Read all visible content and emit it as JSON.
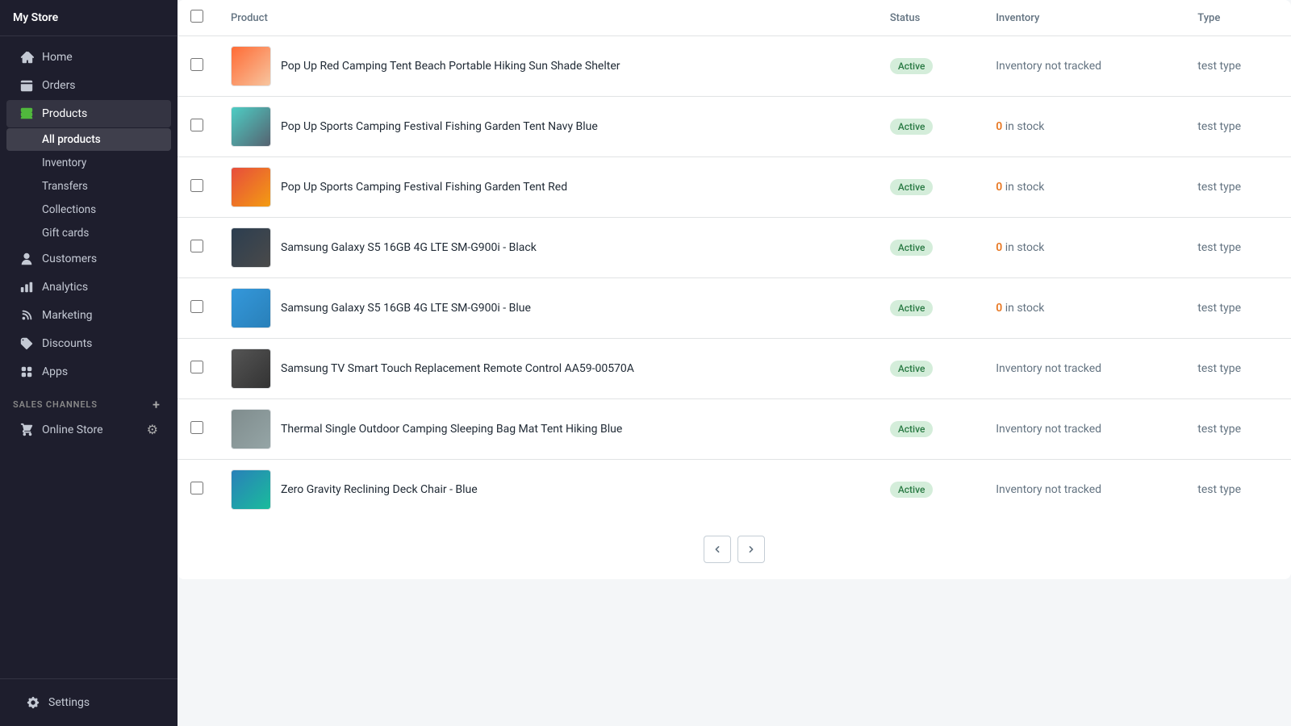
{
  "sidebar": {
    "store_name": "My Store",
    "nav_items": [
      {
        "id": "home",
        "label": "Home",
        "icon": "home"
      },
      {
        "id": "orders",
        "label": "Orders",
        "icon": "orders"
      },
      {
        "id": "products",
        "label": "Products",
        "icon": "products",
        "active": true
      }
    ],
    "products_sub": [
      {
        "id": "all-products",
        "label": "All products",
        "active": true
      },
      {
        "id": "inventory",
        "label": "Inventory"
      },
      {
        "id": "transfers",
        "label": "Transfers"
      },
      {
        "id": "collections",
        "label": "Collections"
      },
      {
        "id": "gift-cards",
        "label": "Gift cards"
      }
    ],
    "more_nav": [
      {
        "id": "customers",
        "label": "Customers",
        "icon": "customers"
      },
      {
        "id": "analytics",
        "label": "Analytics",
        "icon": "analytics"
      },
      {
        "id": "marketing",
        "label": "Marketing",
        "icon": "marketing"
      },
      {
        "id": "discounts",
        "label": "Discounts",
        "icon": "discounts"
      },
      {
        "id": "apps",
        "label": "Apps",
        "icon": "apps"
      }
    ],
    "sales_channels_label": "SALES CHANNELS",
    "online_store_label": "Online Store",
    "settings_label": "Settings"
  },
  "table": {
    "columns": [
      {
        "id": "checkbox",
        "label": ""
      },
      {
        "id": "product",
        "label": "Product"
      },
      {
        "id": "status",
        "label": "Status"
      },
      {
        "id": "inventory",
        "label": "Inventory"
      },
      {
        "id": "type",
        "label": "Type"
      }
    ],
    "rows": [
      {
        "id": 1,
        "name": "Pop Up Red Camping Tent Beach Portable Hiking Sun Shade Shelter",
        "status": "Active",
        "inventory": "Inventory not tracked",
        "inventory_type": "not_tracked",
        "type": "test type",
        "thumb_class": "thumb-tent-red"
      },
      {
        "id": 2,
        "name": "Pop Up Sports Camping Festival Fishing Garden Tent Navy Blue",
        "status": "Active",
        "inventory": "in stock",
        "inventory_type": "zero_stock",
        "inventory_count": "0",
        "type": "test type",
        "thumb_class": "thumb-tent-blue"
      },
      {
        "id": 3,
        "name": "Pop Up Sports Camping Festival Fishing Garden Tent Red",
        "status": "Active",
        "inventory": "in stock",
        "inventory_type": "zero_stock",
        "inventory_count": "0",
        "type": "test type",
        "thumb_class": "thumb-tent-red2"
      },
      {
        "id": 4,
        "name": "Samsung Galaxy S5 16GB 4G LTE SM-G900i - Black",
        "status": "Active",
        "inventory": "in stock",
        "inventory_type": "zero_stock",
        "inventory_count": "0",
        "type": "test type",
        "thumb_class": "thumb-phone-black"
      },
      {
        "id": 5,
        "name": "Samsung Galaxy S5 16GB 4G LTE SM-G900i - Blue",
        "status": "Active",
        "inventory": "in stock",
        "inventory_type": "zero_stock",
        "inventory_count": "0",
        "type": "test type",
        "thumb_class": "thumb-phone-blue"
      },
      {
        "id": 6,
        "name": "Samsung TV Smart Touch Replacement Remote Control AA59-00570A",
        "status": "Active",
        "inventory": "Inventory not tracked",
        "inventory_type": "not_tracked",
        "type": "test type",
        "thumb_class": "thumb-remote"
      },
      {
        "id": 7,
        "name": "Thermal Single Outdoor Camping Sleeping Bag Mat Tent Hiking Blue",
        "status": "Active",
        "inventory": "Inventory not tracked",
        "inventory_type": "not_tracked",
        "type": "test type",
        "thumb_class": "thumb-sleeping-bag"
      },
      {
        "id": 8,
        "name": "Zero Gravity Reclining Deck Chair - Blue",
        "status": "Active",
        "inventory": "Inventory not tracked",
        "inventory_type": "not_tracked",
        "type": "test type",
        "thumb_class": "thumb-chair"
      }
    ]
  },
  "pagination": {
    "prev_label": "‹",
    "next_label": "›"
  }
}
